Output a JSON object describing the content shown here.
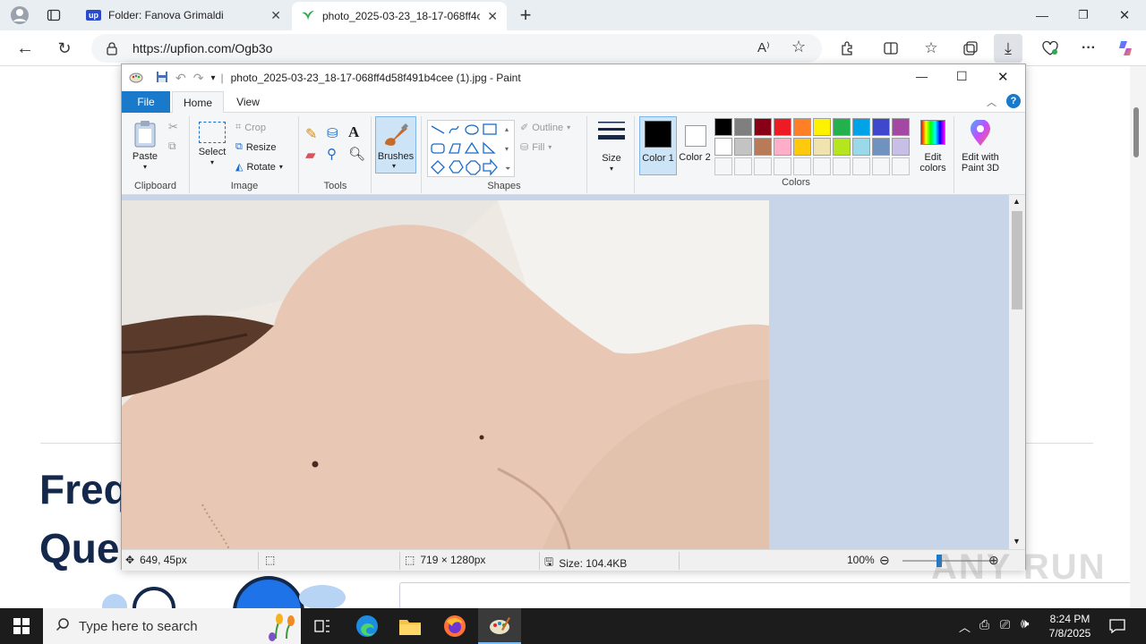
{
  "browser": {
    "tabs": [
      {
        "label": "Folder: Fanova Grimaldi",
        "favicon": "up"
      },
      {
        "label": "photo_2025-03-23_18-17-068ff4c",
        "active": true
      }
    ],
    "url": "https://upfion.com/Ogb3o"
  },
  "webpage": {
    "heading_line1": "Freq",
    "heading_line2": "Que"
  },
  "paint": {
    "title": "photo_2025-03-23_18-17-068ff4d58f491b4cee (1).jpg - Paint",
    "ribbon_tabs": [
      "File",
      "Home",
      "View"
    ],
    "clipboard": {
      "paste": "Paste",
      "group": "Clipboard"
    },
    "image": {
      "select": "Select",
      "crop": "Crop",
      "resize": "Resize",
      "rotate": "Rotate",
      "group": "Image"
    },
    "tools": {
      "group": "Tools"
    },
    "brushes": "Brushes",
    "shapes": {
      "outline": "Outline",
      "fill": "Fill",
      "group": "Shapes"
    },
    "size": "Size",
    "color1": "Color 1",
    "color2": "Color 2",
    "colors_group": "Colors",
    "edit_colors": "Edit colors",
    "edit_paint3d": "Edit with Paint 3D",
    "palette_row1": [
      "#000000",
      "#7f7f7f",
      "#880015",
      "#ed1c24",
      "#ff7f27",
      "#fff200",
      "#22b14c",
      "#00a2e8",
      "#3f48cc",
      "#a349a4"
    ],
    "palette_row2": [
      "#ffffff",
      "#c3c3c3",
      "#b97a57",
      "#ffaec9",
      "#ffc90e",
      "#efe4b0",
      "#b5e61d",
      "#99d9ea",
      "#7092be",
      "#c8bfe7"
    ],
    "status": {
      "cursor": "649, 45px",
      "dimensions": "719 × 1280px",
      "size": "Size: 104.4KB",
      "zoom": "100%"
    }
  },
  "taskbar": {
    "search_placeholder": "Type here to search",
    "time": "8:24 PM",
    "date": "7/8/2025"
  },
  "watermark": "ANY RUN"
}
